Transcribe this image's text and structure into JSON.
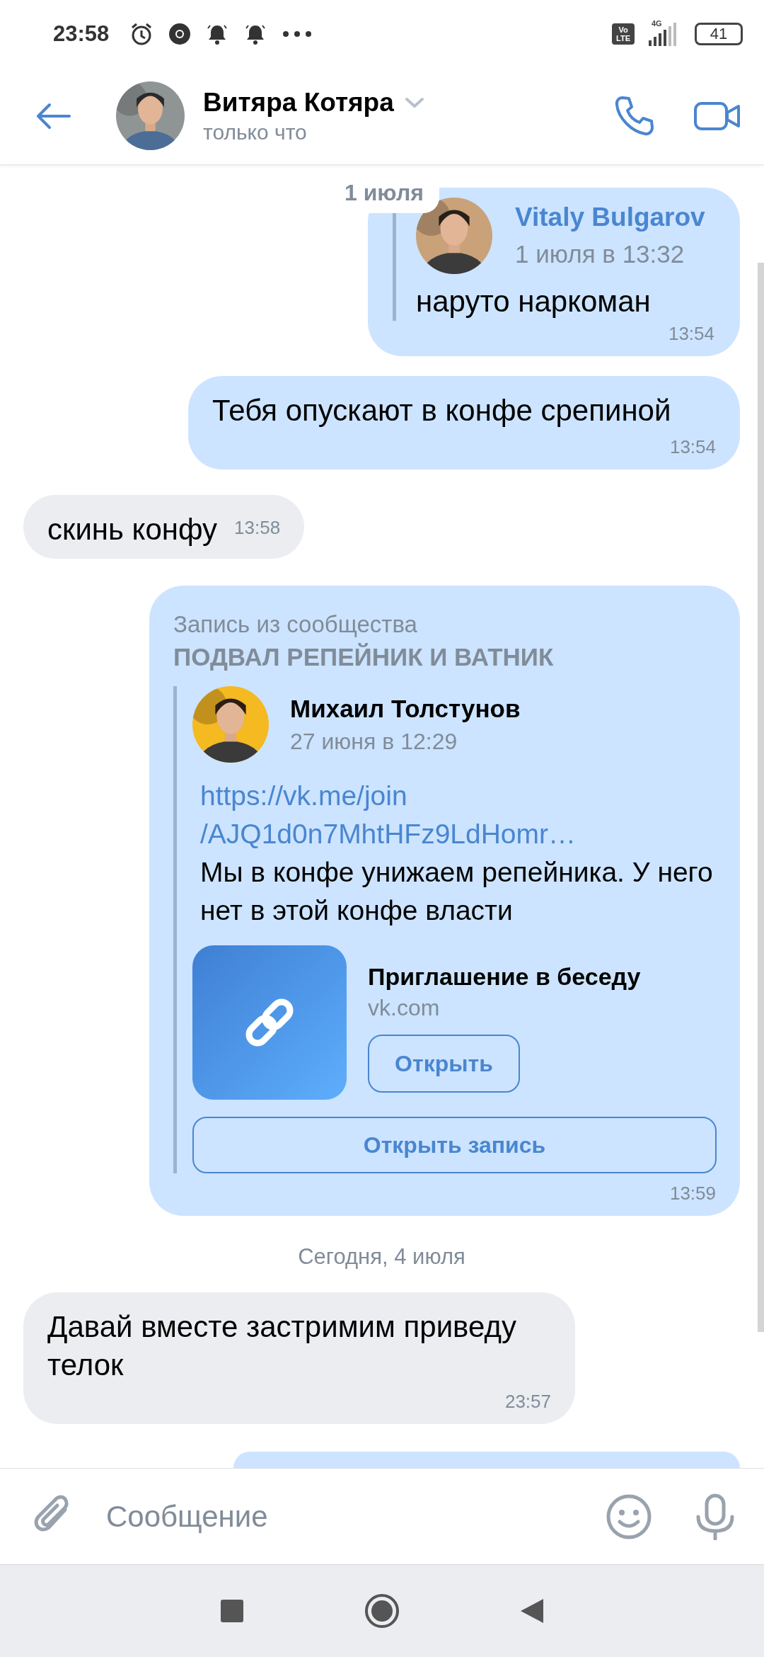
{
  "status_bar": {
    "time": "23:58",
    "volte": [
      "Vo",
      "LTE"
    ],
    "network": "4G",
    "battery": "41"
  },
  "header": {
    "name": "Витяра Котяра",
    "status": "только что"
  },
  "floating_date": "1 июля",
  "messages": [
    {
      "kind": "reply",
      "outgoing": true,
      "reply": {
        "author": "Vitaly Bulgarov",
        "date": "1 июля в 13:32"
      },
      "text": "наруто наркоман",
      "time": "13:54"
    },
    {
      "kind": "text",
      "outgoing": true,
      "text": "Тебя опускают в конфе срепиной",
      "time": "13:54"
    },
    {
      "kind": "text",
      "outgoing": false,
      "text": "скинь конфу",
      "time": "13:58"
    },
    {
      "kind": "post",
      "outgoing": true,
      "source_label": "Запись из сообщества",
      "community": "ПОДВАЛ РЕПЕЙНИК И ВАТНИК",
      "author": "Михаил Толстунов",
      "date": "27 июня в 12:29",
      "link_lines": [
        "https://vk.me/join",
        "/AJQ1d0n7MhtHFz9LdHomr…"
      ],
      "text": "Мы в конфе унижаем репейника. У него нет в этой конфе власти",
      "attachment": {
        "title": "Приглашение в беседу",
        "domain": "vk.com",
        "button": "Открыть"
      },
      "open_button": "Открыть запись",
      "time": "13:59"
    },
    {
      "kind": "date",
      "text": "Сегодня, 4 июля"
    },
    {
      "kind": "text",
      "outgoing": false,
      "text": "Давай вместе застримим приведу телок",
      "time": "23:57"
    },
    {
      "kind": "partial",
      "outgoing": true
    }
  ],
  "composer": {
    "placeholder": "Сообщение"
  }
}
